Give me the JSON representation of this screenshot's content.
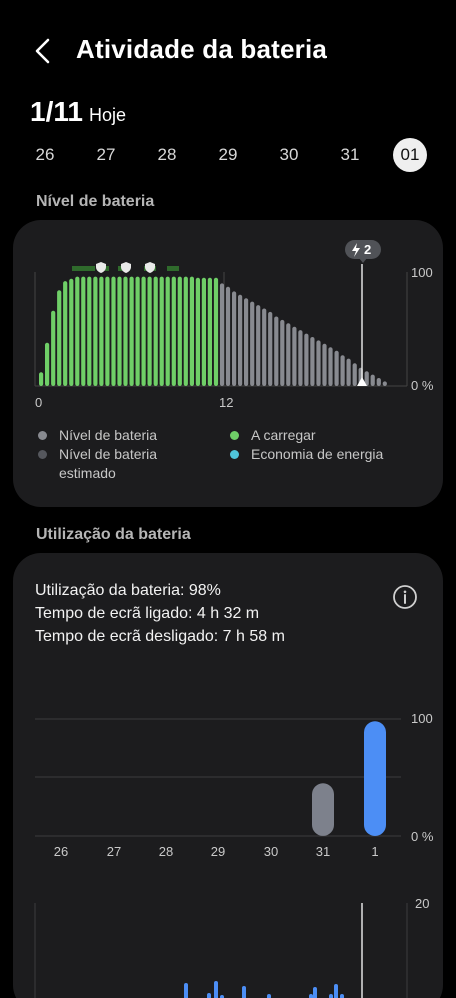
{
  "header": {
    "title": "Atividade da bateria"
  },
  "date": {
    "main": "1/11",
    "sub": "Hoje"
  },
  "days": [
    "26",
    "27",
    "28",
    "29",
    "30",
    "31",
    "01"
  ],
  "selected_day": "01",
  "level_section": {
    "label": "Nível de bateria",
    "charge_badge": "2",
    "y_max_label": "100",
    "y_min_label": "0 %",
    "x_labels": [
      "0",
      "12"
    ],
    "legend": [
      {
        "label": "Nível de bateria",
        "color": "#888a90"
      },
      {
        "label": "Nível de bateria estimado",
        "color": "#55575d"
      },
      {
        "label": "A carregar",
        "color": "#6fcf67"
      },
      {
        "label": "Economia de energia",
        "color": "#4fc4d9"
      }
    ]
  },
  "usage_section": {
    "label": "Utilização da bateria",
    "lines": [
      "Utilização da bateria: 98%",
      "Tempo de ecrã ligado: 4 h 32 m",
      "Tempo de ecrã desligado: 7 h 58 m"
    ],
    "y_max_label": "100",
    "y_min_label": "0 %",
    "x_labels": [
      "26",
      "27",
      "28",
      "29",
      "30",
      "31",
      "1"
    ],
    "hourly_y_max_label": "20"
  },
  "chart_data": [
    {
      "type": "bar",
      "title": "Nível de bateria",
      "unit": "%",
      "ylim": [
        0,
        100
      ],
      "x_ticks": [
        "0",
        "12"
      ],
      "series": [
        {
          "name": "A carregar",
          "values": [
            12,
            38,
            66,
            84,
            92,
            94,
            96,
            96,
            96,
            96,
            96,
            96,
            96,
            96,
            96,
            96,
            96,
            96,
            96,
            96,
            96,
            96,
            96,
            96,
            96,
            96,
            95,
            95,
            95,
            95
          ]
        },
        {
          "name": "Nível de bateria",
          "values": [
            90,
            87,
            83,
            80,
            77,
            74,
            71,
            68,
            65,
            61,
            58,
            55,
            52,
            49,
            46,
            43,
            40,
            37,
            34,
            31,
            27,
            24,
            20,
            16,
            13,
            10,
            7,
            4
          ]
        }
      ]
    },
    {
      "type": "bar",
      "title": "Utilização da bateria",
      "unit": "%",
      "categories": [
        "26",
        "27",
        "28",
        "29",
        "30",
        "31",
        "1"
      ],
      "values": [
        0,
        0,
        0,
        0,
        0,
        45,
        98
      ],
      "ylim": [
        0,
        100
      ]
    }
  ]
}
